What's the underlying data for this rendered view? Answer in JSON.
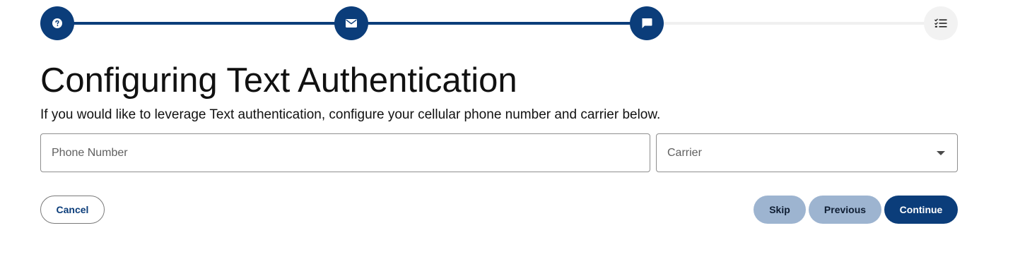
{
  "stepper": {
    "steps": [
      {
        "icon": "question-circle-icon",
        "status": "complete"
      },
      {
        "icon": "envelope-icon",
        "status": "complete"
      },
      {
        "icon": "chat-bubble-icon",
        "status": "current"
      },
      {
        "icon": "checklist-icon",
        "status": "upcoming"
      }
    ],
    "colors": {
      "complete": "#0b3d7a",
      "upcoming": "#f2f2f2"
    }
  },
  "page": {
    "title": "Configuring Text Authentication",
    "subtitle": "If you would like to leverage Text authentication, configure your cellular phone number and carrier below."
  },
  "form": {
    "phone": {
      "placeholder": "Phone Number",
      "value": ""
    },
    "carrier": {
      "selected_label": "Carrier"
    }
  },
  "actions": {
    "cancel_label": "Cancel",
    "skip_label": "Skip",
    "previous_label": "Previous",
    "continue_label": "Continue"
  },
  "colors": {
    "primary": "#0b3d7a",
    "secondary_button": "#9db4d0"
  }
}
